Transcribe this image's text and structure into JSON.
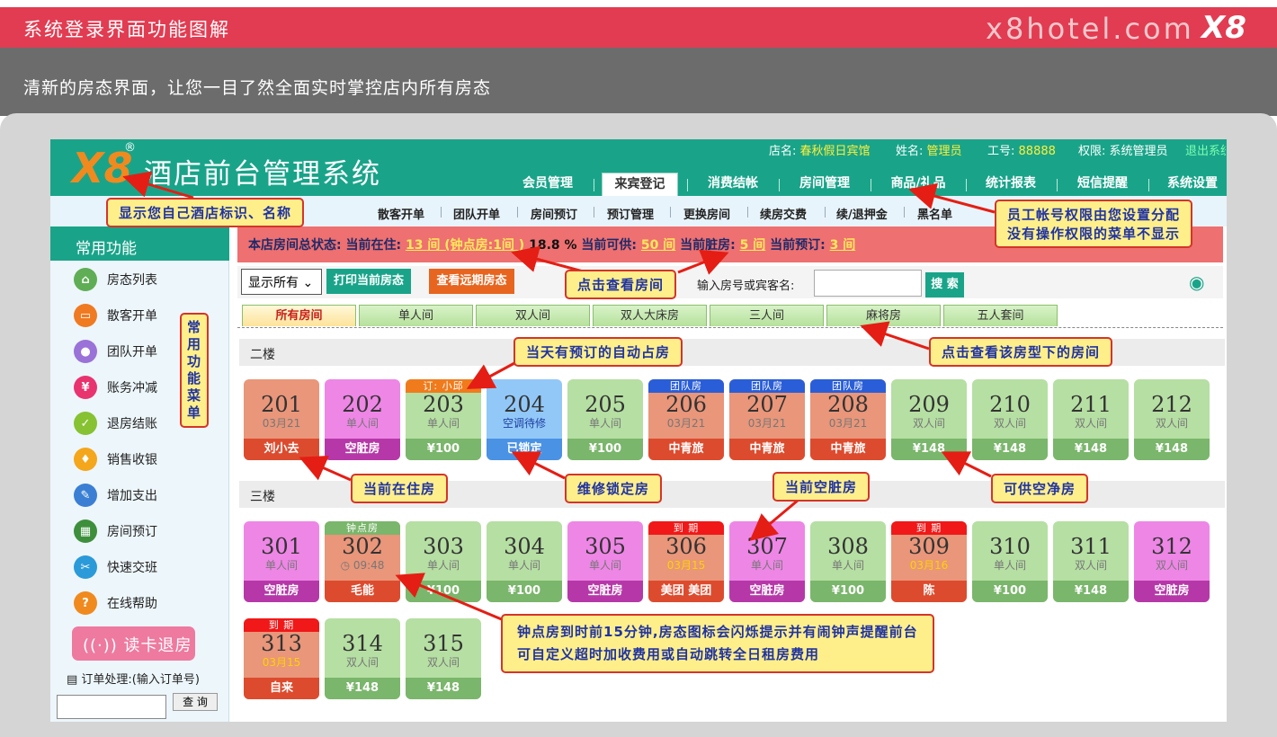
{
  "banner": {
    "title": "系统登录界面功能图解",
    "brand": "x8hotel.com",
    "logo": "X8"
  },
  "subtitle": "清新的房态界面，让您一目了然全面实时掌控店内所有房态",
  "header": {
    "logo": "X8",
    "reg": "®",
    "title": "酒店前台管理系统",
    "info": {
      "hotel_label": "店名:",
      "hotel": "春秋假日宾馆",
      "name_label": "姓名:",
      "name": "管理员",
      "id_label": "工号:",
      "id": "88888",
      "role_label": "权限:",
      "role": "系统管理员",
      "logout": "退出系统"
    },
    "nav": [
      "会员管理",
      "来宾登记",
      "消费结帐",
      "房间管理",
      "商品/礼品",
      "统计报表",
      "短信提醒",
      "系统设置"
    ]
  },
  "subnav": [
    "散客开单",
    "团队开单",
    "房间预订",
    "预订管理",
    "更换房间",
    "续房交费",
    "续/退押金",
    "黑名单"
  ],
  "sidebar": {
    "title": "常用功能",
    "items": [
      {
        "label": "房态列表",
        "icon": "home-icon",
        "color": "#5fae56",
        "glyph": "⌂"
      },
      {
        "label": "散客开单",
        "icon": "card-icon",
        "color": "#ef7a22",
        "glyph": "▭"
      },
      {
        "label": "团队开单",
        "icon": "group-icon",
        "color": "#9a72d8",
        "glyph": "●"
      },
      {
        "label": "账务冲减",
        "icon": "yen-icon",
        "color": "#e8336f",
        "glyph": "¥"
      },
      {
        "label": "退房结账",
        "icon": "checkout-icon",
        "color": "#86c232",
        "glyph": "✓"
      },
      {
        "label": "销售收银",
        "icon": "cart-icon",
        "color": "#f4a61c",
        "glyph": "♦"
      },
      {
        "label": "增加支出",
        "icon": "pen-icon",
        "color": "#3a7fd4",
        "glyph": "✎"
      },
      {
        "label": "房间预订",
        "icon": "calendar-icon",
        "color": "#3d8f3c",
        "glyph": "▦"
      },
      {
        "label": "快速交班",
        "icon": "key-icon",
        "color": "#2b9ad8",
        "glyph": "✂"
      },
      {
        "label": "在线帮助",
        "icon": "help-icon",
        "color": "#f08a1e",
        "glyph": "?"
      }
    ],
    "readcard": "读卡退房",
    "order_label": "订单处理:(输入订单号)",
    "order_btn": "查 询",
    "vertical": "常用功能菜单"
  },
  "status": {
    "prefix": "本店房间总状态:",
    "occ_label": "当前在住:",
    "occ": "13 间 (钟点房:1间 )",
    "rate": "18.8 %",
    "avail_label": "当前可供:",
    "avail": "50 间",
    "dirty_label": "当前脏房:",
    "dirty": "5 间",
    "book_label": "当前预订:",
    "book": "3 间"
  },
  "toolbar": {
    "select": "显示所有",
    "print": "打印当前房态",
    "future": "查看远期房态",
    "search_label": "输入房号或宾客名:",
    "search_btn": "搜 索"
  },
  "tabs": [
    "所有房间",
    "单人间",
    "双人间",
    "双人大床房",
    "三人间",
    "麻将房",
    "五人套间"
  ],
  "floors": [
    "二楼",
    "三楼"
  ],
  "rooms_f2": [
    {
      "num": "201",
      "lab": "03月21",
      "bot": "刘小去",
      "st": "occ"
    },
    {
      "num": "202",
      "lab": "单人间",
      "bot": "空脏房",
      "st": "dirty"
    },
    {
      "num": "203",
      "lab": "单人间",
      "bot": "¥100",
      "st": "clean",
      "tag": "订: 小邱",
      "tagc": "o"
    },
    {
      "num": "204",
      "lab": "空调待修",
      "bot": "已锁定",
      "st": "lock"
    },
    {
      "num": "205",
      "lab": "单人间",
      "bot": "¥100",
      "st": "clean"
    },
    {
      "num": "206",
      "lab": "03月21",
      "bot": "中青旅",
      "st": "occ",
      "tag": "团队房",
      "tagc": "b"
    },
    {
      "num": "207",
      "lab": "03月21",
      "bot": "中青旅",
      "st": "occ",
      "tag": "团队房",
      "tagc": "b"
    },
    {
      "num": "208",
      "lab": "03月21",
      "bot": "中青旅",
      "st": "occ",
      "tag": "团队房",
      "tagc": "b"
    },
    {
      "num": "209",
      "lab": "双人间",
      "bot": "¥148",
      "st": "clean"
    },
    {
      "num": "210",
      "lab": "双人间",
      "bot": "¥148",
      "st": "clean"
    },
    {
      "num": "211",
      "lab": "双人间",
      "bot": "¥148",
      "st": "clean"
    },
    {
      "num": "212",
      "lab": "双人间",
      "bot": "¥148",
      "st": "clean"
    }
  ],
  "rooms_f3": [
    {
      "num": "301",
      "lab": "单人间",
      "bot": "空脏房",
      "st": "dirty"
    },
    {
      "num": "302",
      "lab": "◷ 09:48",
      "bot": "毛能",
      "st": "occ",
      "tag": "钟点房",
      "tagc": "g"
    },
    {
      "num": "303",
      "lab": "单人间",
      "bot": "¥100",
      "st": "clean"
    },
    {
      "num": "304",
      "lab": "单人间",
      "bot": "¥100",
      "st": "clean"
    },
    {
      "num": "305",
      "lab": "单人间",
      "bot": "空脏房",
      "st": "dirty"
    },
    {
      "num": "306",
      "lab": "03月15",
      "bot": "美团 美团",
      "st": "occ",
      "tag": "到 期",
      "tagc": "r",
      "yel": true
    },
    {
      "num": "307",
      "lab": "单人间",
      "bot": "空脏房",
      "st": "dirty"
    },
    {
      "num": "308",
      "lab": "单人间",
      "bot": "¥100",
      "st": "clean"
    },
    {
      "num": "309",
      "lab": "03月16",
      "bot": "陈",
      "st": "occ",
      "tag": "到 期",
      "tagc": "r",
      "yel": true
    },
    {
      "num": "310",
      "lab": "单人间",
      "bot": "¥100",
      "st": "clean"
    },
    {
      "num": "311",
      "lab": "双人间",
      "bot": "¥148",
      "st": "clean"
    },
    {
      "num": "312",
      "lab": "双人间",
      "bot": "空脏房",
      "st": "dirty"
    },
    {
      "num": "313",
      "lab": "03月15",
      "bot": "自来",
      "st": "occ",
      "tag": "到 期",
      "tagc": "r",
      "yel": true
    },
    {
      "num": "314",
      "lab": "双人间",
      "bot": "¥148",
      "st": "clean"
    },
    {
      "num": "315",
      "lab": "双人间",
      "bot": "¥148",
      "st": "clean"
    }
  ],
  "annotations": {
    "logo": "显示您自己酒店标识、名称",
    "perm1": "员工帐号权限由您设置分配",
    "perm2": "没有操作权限的菜单不显示",
    "view": "点击查看房间",
    "autobook": "当天有预订的自动占房",
    "roomtype": "点击查看该房型下的房间",
    "occupied": "当前在住房",
    "lock": "维修锁定房",
    "dirty": "当前空脏房",
    "clean": "可供空净房",
    "hourly1": "钟点房到时前15分钟,房态图标会闪烁提示并有闹钟声提醒前台",
    "hourly2": "可自定义超时加收费用或自动跳转全日租房费用"
  }
}
